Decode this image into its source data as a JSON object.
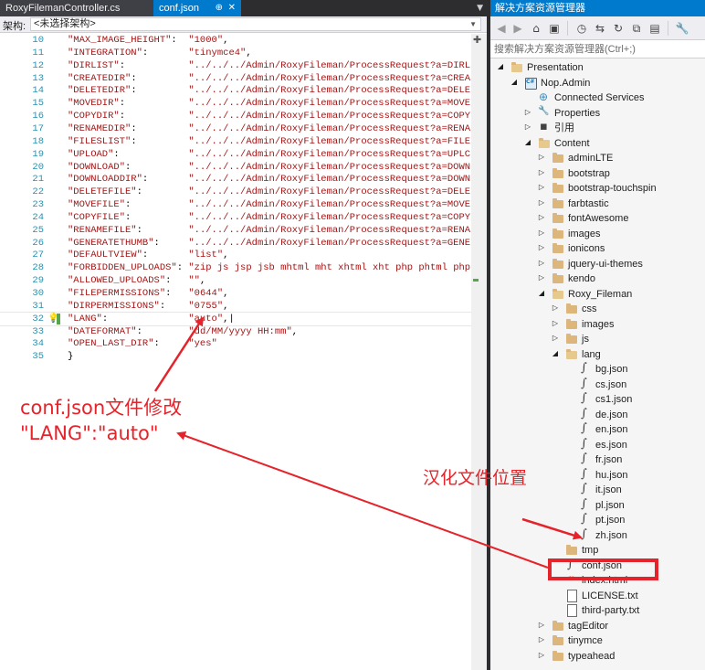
{
  "tabs": [
    {
      "label": "RoxyFilemanController.cs",
      "active": false
    },
    {
      "label": "conf.json",
      "active": true
    }
  ],
  "tab_pin": "⊕",
  "tab_close": "✕",
  "navbar": {
    "label": "架构:",
    "value": "<未选择架构>"
  },
  "code_lines": [
    {
      "num": "10",
      "key": "\"MAX_IMAGE_HEIGHT\"",
      "value": "\"1000\"",
      "end": ","
    },
    {
      "num": "11",
      "key": "\"INTEGRATION\"",
      "value": "\"tinymce4\"",
      "end": ","
    },
    {
      "num": "12",
      "key": "\"DIRLIST\"",
      "value": "\"../../../Admin/RoxyFileman/ProcessRequest?a=DIRL",
      "end": ""
    },
    {
      "num": "13",
      "key": "\"CREATEDIR\"",
      "value": "\"../../../Admin/RoxyFileman/ProcessRequest?a=CREA",
      "end": ""
    },
    {
      "num": "14",
      "key": "\"DELETEDIR\"",
      "value": "\"../../../Admin/RoxyFileman/ProcessRequest?a=DELE",
      "end": ""
    },
    {
      "num": "15",
      "key": "\"MOVEDIR\"",
      "value": "\"../../../Admin/RoxyFileman/ProcessRequest?a=MOVE",
      "end": ""
    },
    {
      "num": "16",
      "key": "\"COPYDIR\"",
      "value": "\"../../../Admin/RoxyFileman/ProcessRequest?a=COPY",
      "end": ""
    },
    {
      "num": "17",
      "key": "\"RENAMEDIR\"",
      "value": "\"../../../Admin/RoxyFileman/ProcessRequest?a=RENA",
      "end": ""
    },
    {
      "num": "18",
      "key": "\"FILESLIST\"",
      "value": "\"../../../Admin/RoxyFileman/ProcessRequest?a=FILE",
      "end": ""
    },
    {
      "num": "19",
      "key": "\"UPLOAD\"",
      "value": "\"../../../Admin/RoxyFileman/ProcessRequest?a=UPLC",
      "end": ""
    },
    {
      "num": "20",
      "key": "\"DOWNLOAD\"",
      "value": "\"../../../Admin/RoxyFileman/ProcessRequest?a=DOWN",
      "end": ""
    },
    {
      "num": "21",
      "key": "\"DOWNLOADDIR\"",
      "value": "\"../../../Admin/RoxyFileman/ProcessRequest?a=DOWN",
      "end": ""
    },
    {
      "num": "22",
      "key": "\"DELETEFILE\"",
      "value": "\"../../../Admin/RoxyFileman/ProcessRequest?a=DELE",
      "end": ""
    },
    {
      "num": "23",
      "key": "\"MOVEFILE\"",
      "value": "\"../../../Admin/RoxyFileman/ProcessRequest?a=MOVE",
      "end": ""
    },
    {
      "num": "24",
      "key": "\"COPYFILE\"",
      "value": "\"../../../Admin/RoxyFileman/ProcessRequest?a=COPY",
      "end": ""
    },
    {
      "num": "25",
      "key": "\"RENAMEFILE\"",
      "value": "\"../../../Admin/RoxyFileman/ProcessRequest?a=RENA",
      "end": ""
    },
    {
      "num": "26",
      "key": "\"GENERATETHUMB\"",
      "value": "\"../../../Admin/RoxyFileman/ProcessRequest?a=GENE",
      "end": ""
    },
    {
      "num": "27",
      "key": "\"DEFAULTVIEW\"",
      "value": "\"list\"",
      "end": ","
    },
    {
      "num": "28",
      "key": "\"FORBIDDEN_UPLOADS\"",
      "value": "\"zip js jsp jsb mhtml mht xhtml xht php phtml php",
      "end": ""
    },
    {
      "num": "29",
      "key": "\"ALLOWED_UPLOADS\"",
      "value": "\"\"",
      "end": ","
    },
    {
      "num": "30",
      "key": "\"FILEPERMISSIONS\"",
      "value": "\"0644\"",
      "end": ","
    },
    {
      "num": "31",
      "key": "\"DIRPERMISSIONS\"",
      "value": "\"0755\"",
      "end": ","
    },
    {
      "num": "32",
      "key": "\"LANG\"",
      "value": "\"auto\"",
      "end": ",|"
    },
    {
      "num": "33",
      "key": "\"DATEFORMAT\"",
      "value": "\"dd/MM/yyyy HH:mm\"",
      "end": ","
    },
    {
      "num": "34",
      "key": "\"OPEN_LAST_DIR\"",
      "value": "\"yes\"",
      "end": ""
    },
    {
      "num": "35",
      "key": "}",
      "value": "",
      "end": ""
    }
  ],
  "solution_explorer": {
    "title": "解决方案资源管理器",
    "search_placeholder": "搜索解决方案资源管理器(Ctrl+;)",
    "tree": [
      {
        "label": "Presentation",
        "indent": 0,
        "arrow": "open",
        "icon": "folder open"
      },
      {
        "label": "Nop.Admin",
        "indent": 1,
        "arrow": "open",
        "icon": "proj"
      },
      {
        "label": "Connected Services",
        "indent": 2,
        "arrow": "",
        "icon": "globe"
      },
      {
        "label": "Properties",
        "indent": 2,
        "arrow": "closed",
        "icon": "wrench"
      },
      {
        "label": "引用",
        "indent": 2,
        "arrow": "closed",
        "icon": "refs"
      },
      {
        "label": "Content",
        "indent": 2,
        "arrow": "open",
        "icon": "folder open"
      },
      {
        "label": "adminLTE",
        "indent": 3,
        "arrow": "closed",
        "icon": "folder"
      },
      {
        "label": "bootstrap",
        "indent": 3,
        "arrow": "closed",
        "icon": "folder"
      },
      {
        "label": "bootstrap-touchspin",
        "indent": 3,
        "arrow": "closed",
        "icon": "folder"
      },
      {
        "label": "farbtastic",
        "indent": 3,
        "arrow": "closed",
        "icon": "folder"
      },
      {
        "label": "fontAwesome",
        "indent": 3,
        "arrow": "closed",
        "icon": "folder"
      },
      {
        "label": "images",
        "indent": 3,
        "arrow": "closed",
        "icon": "folder"
      },
      {
        "label": "ionicons",
        "indent": 3,
        "arrow": "closed",
        "icon": "folder"
      },
      {
        "label": "jquery-ui-themes",
        "indent": 3,
        "arrow": "closed",
        "icon": "folder"
      },
      {
        "label": "kendo",
        "indent": 3,
        "arrow": "closed",
        "icon": "folder"
      },
      {
        "label": "Roxy_Fileman",
        "indent": 3,
        "arrow": "open",
        "icon": "folder open"
      },
      {
        "label": "css",
        "indent": 4,
        "arrow": "closed",
        "icon": "folder"
      },
      {
        "label": "images",
        "indent": 4,
        "arrow": "closed",
        "icon": "folder"
      },
      {
        "label": "js",
        "indent": 4,
        "arrow": "closed",
        "icon": "folder"
      },
      {
        "label": "lang",
        "indent": 4,
        "arrow": "open",
        "icon": "folder open"
      },
      {
        "label": "bg.json",
        "indent": 5,
        "arrow": "",
        "icon": "json"
      },
      {
        "label": "cs.json",
        "indent": 5,
        "arrow": "",
        "icon": "json"
      },
      {
        "label": "cs1.json",
        "indent": 5,
        "arrow": "",
        "icon": "json"
      },
      {
        "label": "de.json",
        "indent": 5,
        "arrow": "",
        "icon": "json"
      },
      {
        "label": "en.json",
        "indent": 5,
        "arrow": "",
        "icon": "json"
      },
      {
        "label": "es.json",
        "indent": 5,
        "arrow": "",
        "icon": "json"
      },
      {
        "label": "fr.json",
        "indent": 5,
        "arrow": "",
        "icon": "json"
      },
      {
        "label": "hu.json",
        "indent": 5,
        "arrow": "",
        "icon": "json"
      },
      {
        "label": "it.json",
        "indent": 5,
        "arrow": "",
        "icon": "json"
      },
      {
        "label": "pl.json",
        "indent": 5,
        "arrow": "",
        "icon": "json"
      },
      {
        "label": "pt.json",
        "indent": 5,
        "arrow": "",
        "icon": "json"
      },
      {
        "label": "zh.json",
        "indent": 5,
        "arrow": "",
        "icon": "json"
      },
      {
        "label": "tmp",
        "indent": 4,
        "arrow": "",
        "icon": "folder"
      },
      {
        "label": "conf.json",
        "indent": 4,
        "arrow": "",
        "icon": "json"
      },
      {
        "label": "index.html",
        "indent": 4,
        "arrow": "",
        "icon": "html"
      },
      {
        "label": "LICENSE.txt",
        "indent": 4,
        "arrow": "",
        "icon": "file"
      },
      {
        "label": "third-party.txt",
        "indent": 4,
        "arrow": "",
        "icon": "file"
      },
      {
        "label": "tagEditor",
        "indent": 3,
        "arrow": "closed",
        "icon": "folder"
      },
      {
        "label": "tinymce",
        "indent": 3,
        "arrow": "closed",
        "icon": "folder"
      },
      {
        "label": "typeahead",
        "indent": 3,
        "arrow": "closed",
        "icon": "folder"
      }
    ]
  },
  "annotations": {
    "line1": "conf.json文件修改",
    "line2": "\"LANG\":\"auto\"",
    "zh_location": "汉化文件位置",
    "color": "#e5232a"
  },
  "colors": {
    "accent": "#007acc",
    "string": "#a31515",
    "line_number": "#2b91af",
    "annotation": "#e5232a"
  }
}
